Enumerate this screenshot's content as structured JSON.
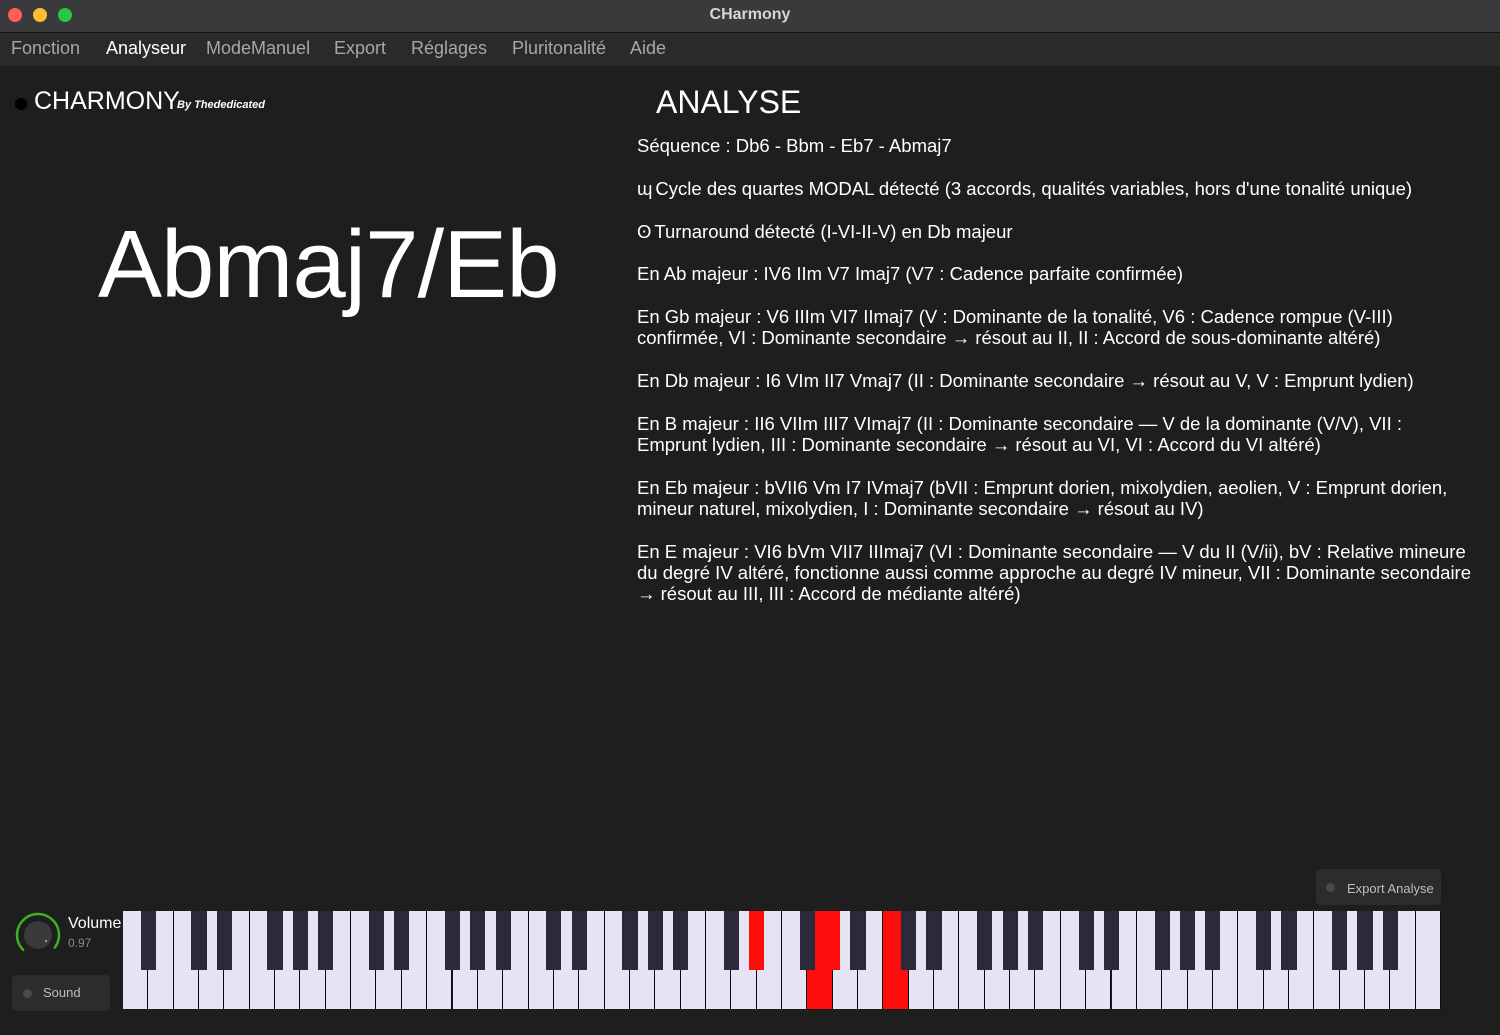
{
  "window": {
    "title": "CHarmony"
  },
  "menu": [
    {
      "label": "Fonction",
      "active": false
    },
    {
      "label": "Analyseur",
      "active": true
    },
    {
      "label": "ModeManuel",
      "active": false
    },
    {
      "label": "Export",
      "active": false
    },
    {
      "label": "Réglages",
      "active": false
    },
    {
      "label": "Pluritonalité",
      "active": false
    },
    {
      "label": "Aide",
      "active": false
    }
  ],
  "logo": {
    "title": "CHARMONY",
    "subtitle": "By Thededicated"
  },
  "chord": {
    "name": "Abmaj7/Eb"
  },
  "analysis": {
    "heading": "ANALYSE",
    "lines": [
      {
        "symbol": "",
        "text": "Séquence : Db6 - Bbm - Eb7 - Abmaj7"
      },
      {
        "symbol": "ɰ",
        "text": "Cycle des quartes MODAL détecté (3 accords, qualités variables, hors d'une tonalité unique)"
      },
      {
        "symbol": "ʘ",
        "text": "Turnaround détecté (I-VI-II-V) en Db majeur"
      },
      {
        "symbol": "",
        "text": "En Ab majeur : IV6 IIm V7 Imaj7 (V7 : Cadence parfaite confirmée)"
      },
      {
        "symbol": "",
        "text": "En Gb majeur : V6 IIIm VI7 IImaj7 (V : Dominante de la tonalité, V6 : Cadence rompue (V-III) confirmée, VI : Dominante secondaire → résout au II, II : Accord de sous-dominante altéré)"
      },
      {
        "symbol": "",
        "text": "En Db majeur : I6 VIm II7 Vmaj7 (II : Dominante secondaire → résout au V, V : Emprunt lydien)"
      },
      {
        "symbol": "",
        "text": "En B majeur : II6 VIIm III7 VImaj7 (II : Dominante secondaire — V de la dominante (V/V), VII : Emprunt lydien, III : Dominante secondaire → résout au VI, VI : Accord du VI altéré)"
      },
      {
        "symbol": "",
        "text": "En Eb majeur : bVII6 Vm I7 IVmaj7 (bVII : Emprunt dorien, mixolydien, aeolien, V : Emprunt dorien, mineur naturel, mixolydien, I : Dominante secondaire → résout au IV)"
      },
      {
        "symbol": "",
        "text": "En E majeur : VI6 bVm VII7 IIImaj7 (VI : Dominante secondaire — V du II (V/ii), bV : Relative mineure du degré IV altéré, fonctionne aussi comme approche au degré IV mineur, VII : Dominante secondaire → résout au III, III : Accord de médiante altéré)"
      }
    ]
  },
  "export_button": {
    "label": "Export Analyse"
  },
  "volume": {
    "label": "Volume",
    "value": "0.97",
    "level": 0.97
  },
  "sound_button": {
    "label": "Sound"
  },
  "keyboard": {
    "white_keys": 52,
    "first_note": "A0",
    "active_notes": [
      "Eb4",
      "G4",
      "Ab4",
      "C5"
    ],
    "accent_color": "#ff0d0d"
  },
  "colors": {
    "background": "#1e1e1e",
    "titlebar": "#3a3a3c",
    "menubar": "#2a2a2a",
    "text": "#ffffff",
    "menu_text": "#a7a7a7",
    "knob_ring": "#3fb01f",
    "white_key": "#e7e3f4",
    "black_key": "#2b2a3b"
  }
}
